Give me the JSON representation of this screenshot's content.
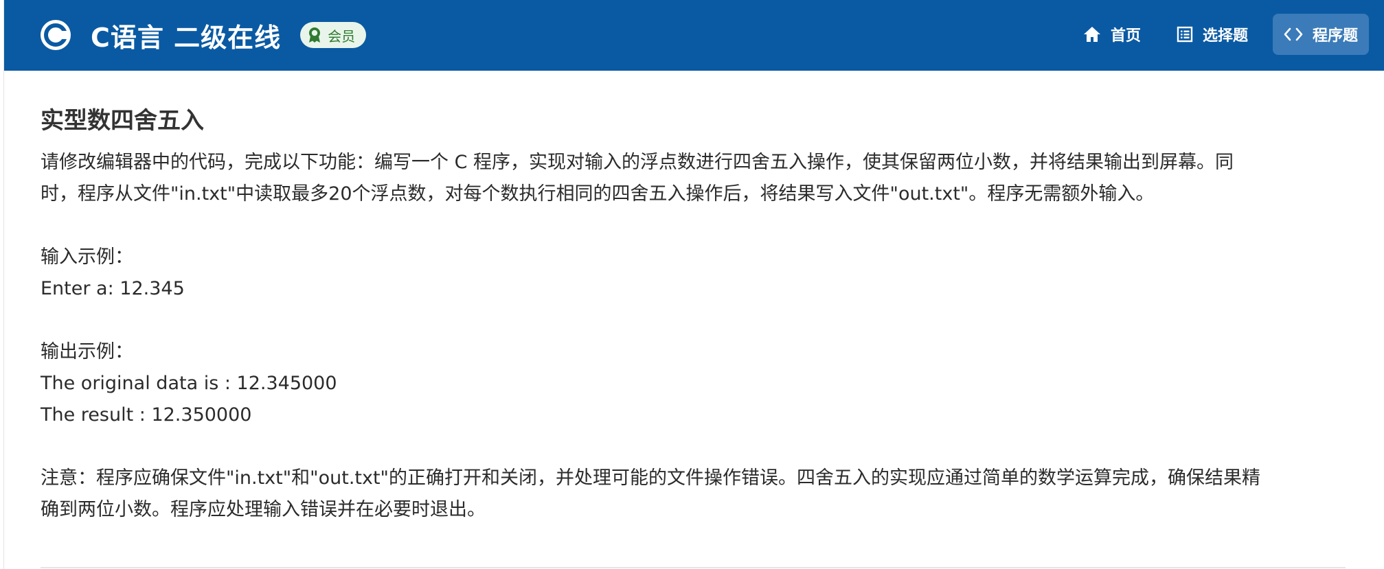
{
  "header": {
    "brand_title": "C语言 二级在线",
    "member_badge": "会员",
    "nav": [
      {
        "label": "首页",
        "icon": "home-icon"
      },
      {
        "label": "选择题",
        "icon": "list-icon"
      },
      {
        "label": "程序题",
        "icon": "code-icon",
        "active": true
      }
    ],
    "colors": {
      "bar": "#0a5aa3",
      "active_tab": "#3b7bb9",
      "badge_bg": "#e9f5ea",
      "badge_text": "#2f7a32"
    }
  },
  "question": {
    "title": "实型数四舍五入",
    "description_line1": "请修改编辑器中的代码，完成以下功能：编写一个 C 程序，实现对输入的浮点数进行四舍五入操作，使其保留两位小数，并将结果输出到屏幕。同",
    "description_line2": "时，程序从文件\"in.txt\"中读取最多20个浮点数，对每个数执行相同的四舍五入操作后，将结果写入文件\"out.txt\"。程序无需额外输入。",
    "input_example_label": "输入示例：",
    "input_example": "Enter a: 12.345",
    "output_example_label": "输出示例：",
    "output_line1": "The original data is : 12.345000",
    "output_line2": "The result : 12.350000",
    "note_line1": "注意：程序应确保文件\"in.txt\"和\"out.txt\"的正确打开和关闭，并处理可能的文件操作错误。四舍五入的实现应通过简单的数学运算完成，确保结果精",
    "note_line2": "确到两位小数。程序应处理输入错误并在必要时退出。"
  }
}
